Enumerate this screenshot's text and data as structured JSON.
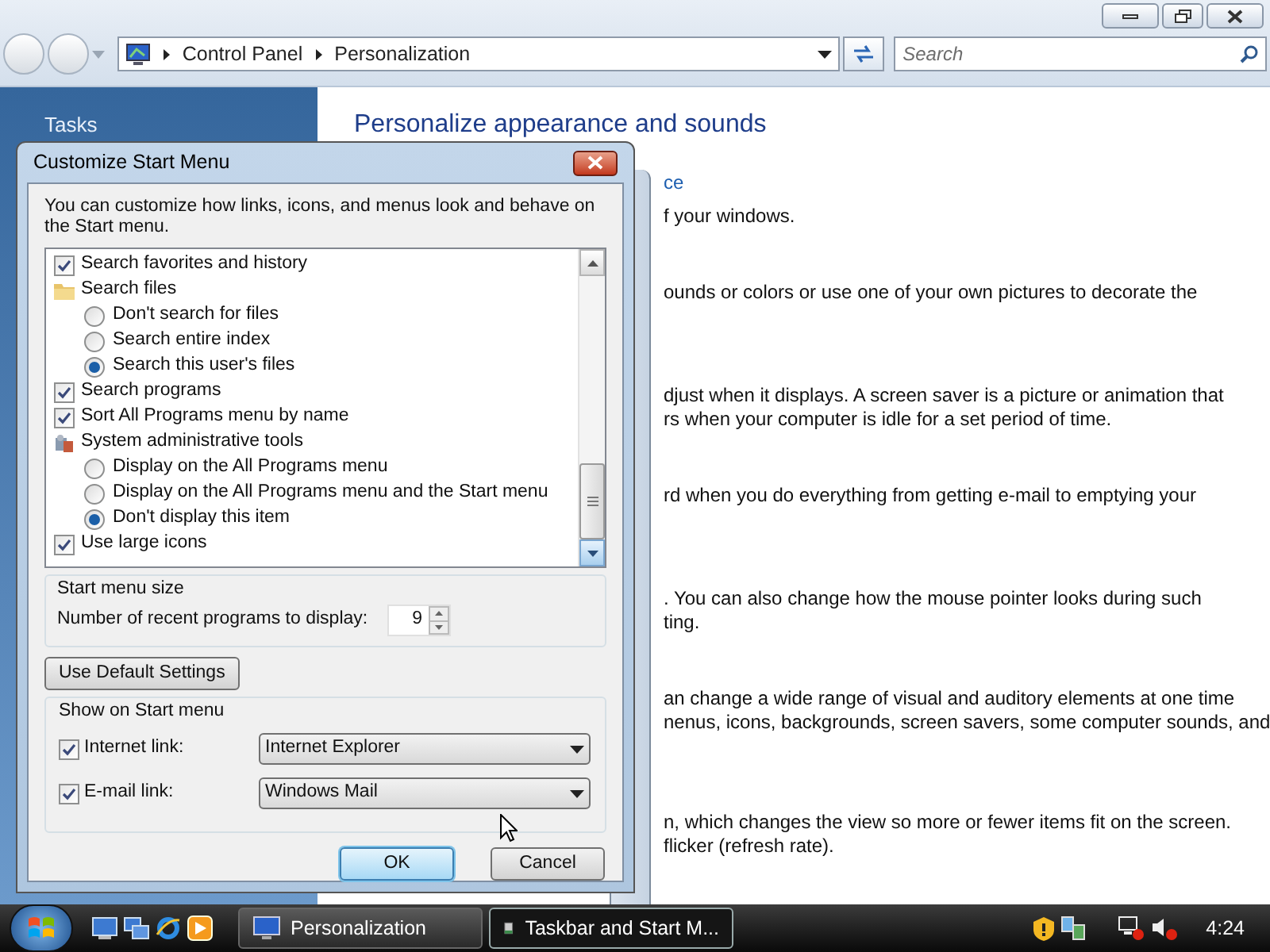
{
  "window": {
    "address": [
      "Control Panel",
      "Personalization"
    ],
    "search": {
      "placeholder": "Search"
    }
  },
  "sidebar": {
    "title": "Tasks"
  },
  "content": {
    "heading": "Personalize appearance and sounds",
    "paragraphs": [
      {
        "kind": "link",
        "lines": [
          "ce"
        ]
      },
      {
        "kind": "text",
        "lines": [
          "f your windows."
        ]
      },
      {
        "kind": "text",
        "lines": [
          "ounds or colors or use one of your own pictures to decorate the"
        ]
      },
      {
        "kind": "text",
        "lines": [
          "djust when it displays. A screen saver is a picture or animation that",
          "rs when your computer is idle for a set period of time."
        ]
      },
      {
        "kind": "text",
        "lines": [
          "rd when you do everything from getting e-mail to emptying your"
        ]
      },
      {
        "kind": "text",
        "lines": [
          ". You can also change how the mouse pointer looks during such",
          "ting."
        ]
      },
      {
        "kind": "text",
        "lines": [
          "an change a wide range of visual and auditory elements at one time",
          "nenus, icons, backgrounds, screen savers, some computer sounds, and"
        ]
      },
      {
        "kind": "text",
        "lines": [
          "n, which changes the view so more or fewer items fit on the screen.",
          "flicker (refresh rate)."
        ]
      }
    ]
  },
  "dialog": {
    "title": "Customize Start Menu",
    "intro": "You can customize how links, icons, and menus look and behave on the Start menu.",
    "options": [
      {
        "kind": "checkbox",
        "label": "Search favorites and history",
        "checked": true
      },
      {
        "kind": "group",
        "label": "Search files",
        "children": [
          {
            "label": "Don't search for files",
            "selected": false
          },
          {
            "label": "Search entire index",
            "selected": false
          },
          {
            "label": "Search this user's files",
            "selected": true
          }
        ]
      },
      {
        "kind": "checkbox",
        "label": "Search programs",
        "checked": true
      },
      {
        "kind": "checkbox",
        "label": "Sort All Programs menu by name",
        "checked": true
      },
      {
        "kind": "group",
        "label": "System administrative tools",
        "children": [
          {
            "label": "Display on the All Programs menu",
            "selected": false
          },
          {
            "label": "Display on the All Programs menu and the Start menu",
            "selected": false
          },
          {
            "label": "Don't display this item",
            "selected": true
          }
        ]
      },
      {
        "kind": "checkbox",
        "label": "Use large icons",
        "checked": true
      }
    ],
    "size_group": "Start menu size",
    "recent_label": "Number of recent programs to display:",
    "recent_value": "9",
    "default_button": "Use Default Settings",
    "show_group": "Show on Start menu",
    "links": [
      {
        "label": "Internet link:",
        "checked": true,
        "value": "Internet Explorer"
      },
      {
        "label": "E-mail link:",
        "checked": true,
        "value": "Windows Mail"
      }
    ],
    "buttons": [
      {
        "label": "OK",
        "default": true
      },
      {
        "label": "Cancel",
        "default": false
      }
    ]
  },
  "taskbar": {
    "tasks": [
      {
        "label": "Personalization",
        "selected": false
      },
      {
        "label": "Taskbar and Start M...",
        "selected": true
      }
    ],
    "clock": "4:24"
  }
}
